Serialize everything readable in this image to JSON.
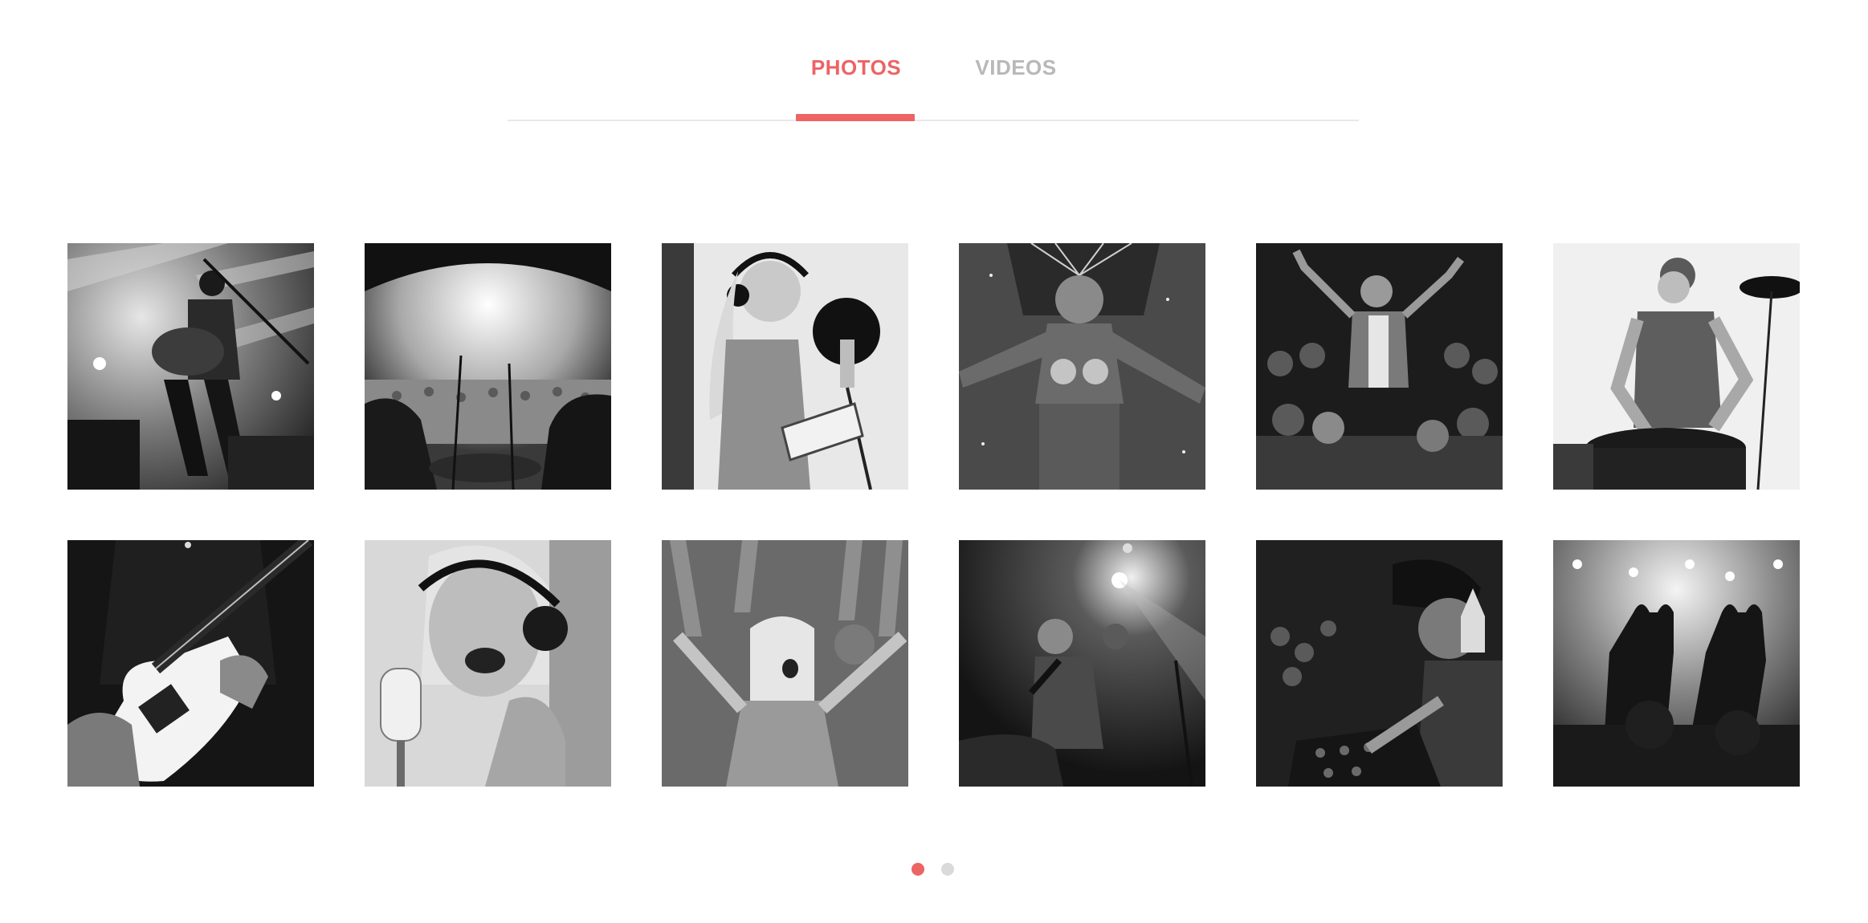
{
  "tabs": {
    "photos_label": "PHOTOS",
    "videos_label": "VIDEOS",
    "active": "photos"
  },
  "colors": {
    "accent": "#ec6464",
    "inactive_tab": "#b8b8b8",
    "inactive_dot": "#dadada",
    "rail": "#e8e8e8"
  },
  "gallery": {
    "items": [
      {
        "subject": "guitarist-on-stage"
      },
      {
        "subject": "stage-view-over-crowd"
      },
      {
        "subject": "singer-with-headphones-and-guitar"
      },
      {
        "subject": "carnival-dancer"
      },
      {
        "subject": "crowd-surfer"
      },
      {
        "subject": "drummer"
      },
      {
        "subject": "electric-guitar-closeup"
      },
      {
        "subject": "singer-at-microphone"
      },
      {
        "subject": "cheering-fan-in-crowd"
      },
      {
        "subject": "performer-with-microphone"
      },
      {
        "subject": "dj-at-mixer"
      },
      {
        "subject": "heart-hands-crowd"
      }
    ]
  },
  "pagination": {
    "pages": 2,
    "current": 1
  }
}
